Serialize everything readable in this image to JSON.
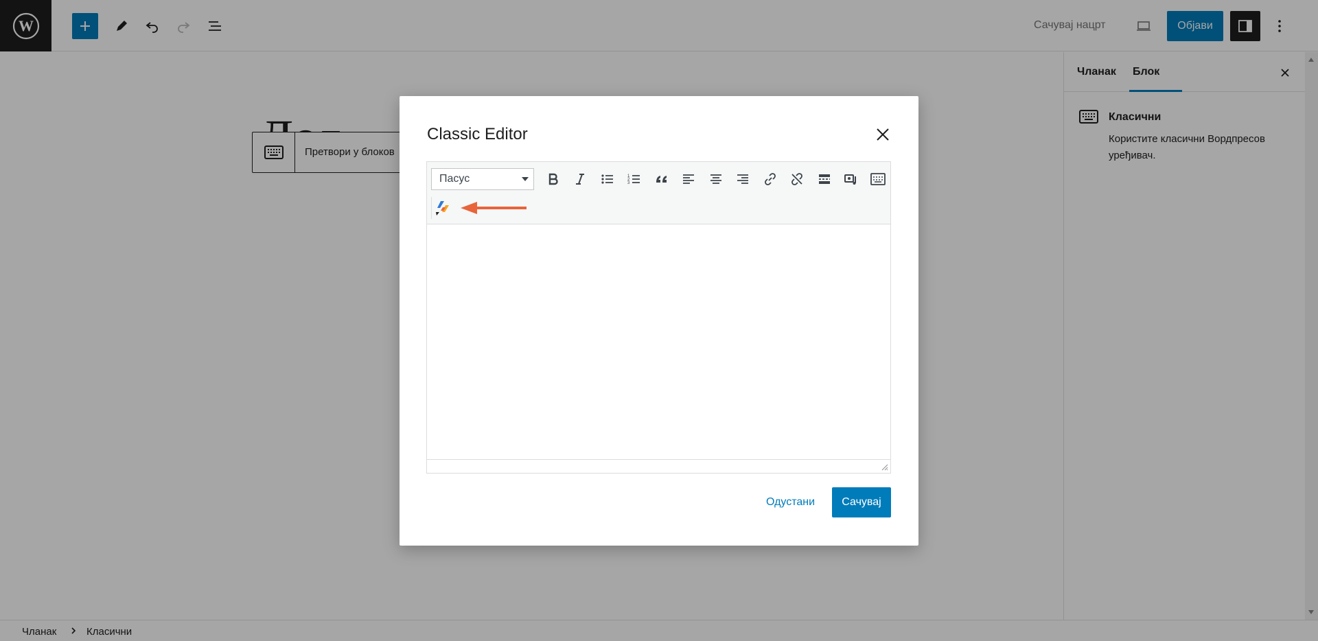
{
  "topbar": {
    "save_draft": "Сачувај нацрт",
    "publish": "Објави"
  },
  "canvas": {
    "title_fragment": "Дод",
    "block_toolbar": {
      "convert_label": "Претвори у блоков"
    }
  },
  "sidebar": {
    "tabs": [
      {
        "label": "Чланак",
        "active": false
      },
      {
        "label": "Блок",
        "active": true
      }
    ],
    "block_card": {
      "icon": "keyboard-icon",
      "title": "Класични",
      "description": "Користите класични Вордпресов уређивач."
    }
  },
  "breadcrumb": {
    "items": [
      "Чланак",
      "Класични"
    ]
  },
  "modal": {
    "title": "Classic Editor",
    "format_select": {
      "value": "Пасус"
    },
    "toolbar_icons": [
      "bold-icon",
      "italic-icon",
      "bullet-list-icon",
      "numbered-list-icon",
      "blockquote-icon",
      "align-left-icon",
      "align-center-icon",
      "align-right-icon",
      "link-icon",
      "unlink-icon",
      "read-more-icon",
      "add-media-icon",
      "toolbar-toggle-icon",
      "plugin-icon"
    ],
    "cancel": "Одустани",
    "save": "Сачувај"
  },
  "colors": {
    "accent": "#007cba",
    "annotation_arrow": "#e8643a",
    "overlay": "rgba(0,0,0,0.35)"
  }
}
